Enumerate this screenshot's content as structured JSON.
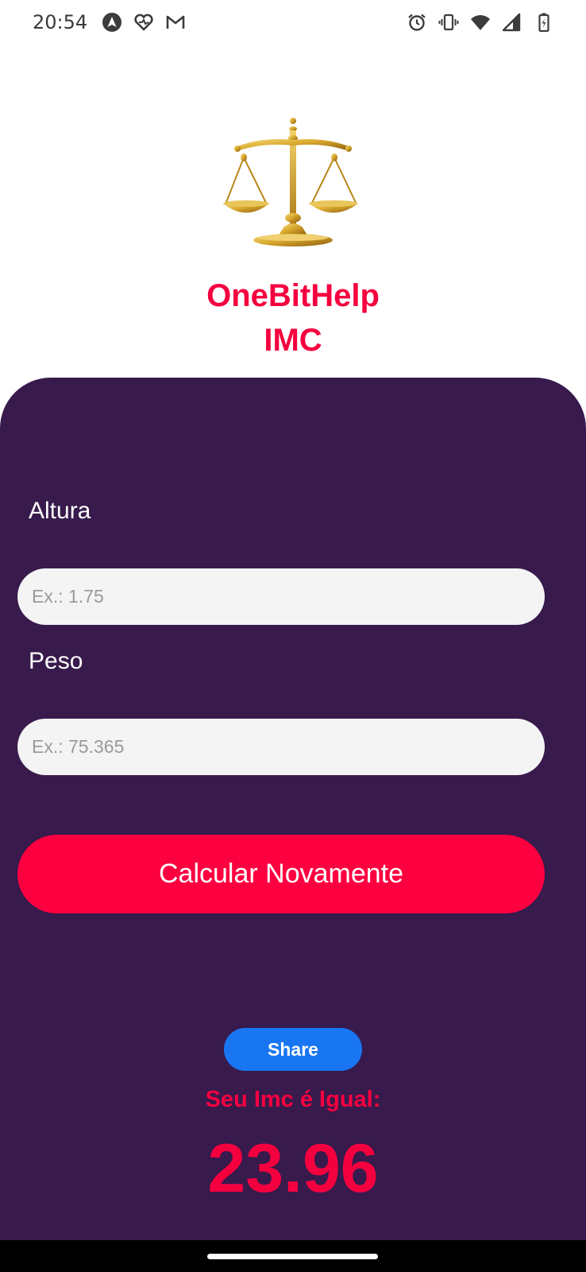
{
  "status_bar": {
    "time": "20:54",
    "left_icons": [
      "navigation-icon",
      "health-icon",
      "gmail-icon"
    ],
    "right_icons": [
      "alarm-icon",
      "vibrate-icon",
      "wifi-icon",
      "signal-icon",
      "battery-charging-icon"
    ]
  },
  "header": {
    "logo_icon": "scales-of-justice-icon",
    "title_line1": "OneBitHelp",
    "title_line2": "IMC",
    "accent_color": "#f5003f"
  },
  "form": {
    "height": {
      "label": "Altura",
      "value": "",
      "placeholder": "Ex.: 1.75"
    },
    "weight": {
      "label": "Peso",
      "value": "",
      "placeholder": "Ex.: 75.365"
    },
    "calculate_button": "Calcular Novamente",
    "panel_color": "#381a4c",
    "button_color": "#fd0040"
  },
  "result": {
    "share_button": "Share",
    "share_color": "#1976f3",
    "label": "Seu Imc é Igual:",
    "value": "23.96"
  }
}
